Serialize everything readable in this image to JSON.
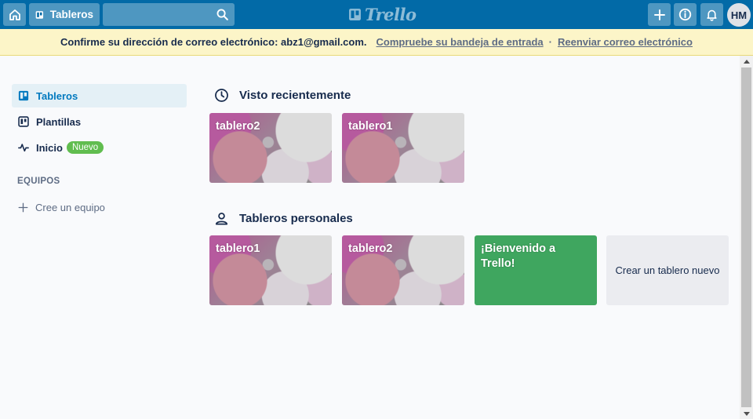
{
  "header": {
    "boards_label": "Tableros",
    "search": {
      "value": "",
      "placeholder": ""
    },
    "logo_text": "Trello",
    "avatar_initials": "HM",
    "icons": {
      "home": "home-icon",
      "boards": "board-icon",
      "search": "search-icon",
      "logo": "trello-logo-icon",
      "add": "plus-icon",
      "info": "info-icon",
      "notifications": "bell-icon"
    },
    "colors": {
      "bar": "#026aa7"
    }
  },
  "banner": {
    "message": "Confirme su dirección de correo electrónico: abz1@gmail.com.",
    "check_inbox_link": "Compruebe su bandeja de entrada",
    "separator": "·",
    "resend_link": "Reenviar correo electrónico",
    "colors": {
      "background": "#fcf5c8"
    }
  },
  "sidebar": {
    "items": [
      {
        "label": "Tableros",
        "icon": "board-icon",
        "active": true
      },
      {
        "label": "Plantillas",
        "icon": "template-icon",
        "active": false
      },
      {
        "label": "Inicio",
        "icon": "activity-icon",
        "active": false,
        "badge": "Nuevo"
      }
    ],
    "teams_title": "EQUIPOS",
    "create_team_label": "Cree un equipo",
    "colors": {
      "active_bg": "#e4f0f6",
      "active_text": "#0079bf",
      "badge": "#61bd4f"
    }
  },
  "recent": {
    "title": "Visto recientemente",
    "icon": "clock-icon",
    "boards": [
      {
        "title": "tablero2"
      },
      {
        "title": "tablero1"
      }
    ]
  },
  "personal": {
    "title": "Tableros personales",
    "icon": "person-icon",
    "boards": [
      {
        "title": "tablero1"
      },
      {
        "title": "tablero2"
      },
      {
        "title": "¡Bienvenido a Trello!"
      }
    ],
    "create_label": "Crear un tablero nuevo",
    "colors": {
      "welcome_board": "#3fa65f",
      "create_tile": "#ebecf0"
    }
  }
}
